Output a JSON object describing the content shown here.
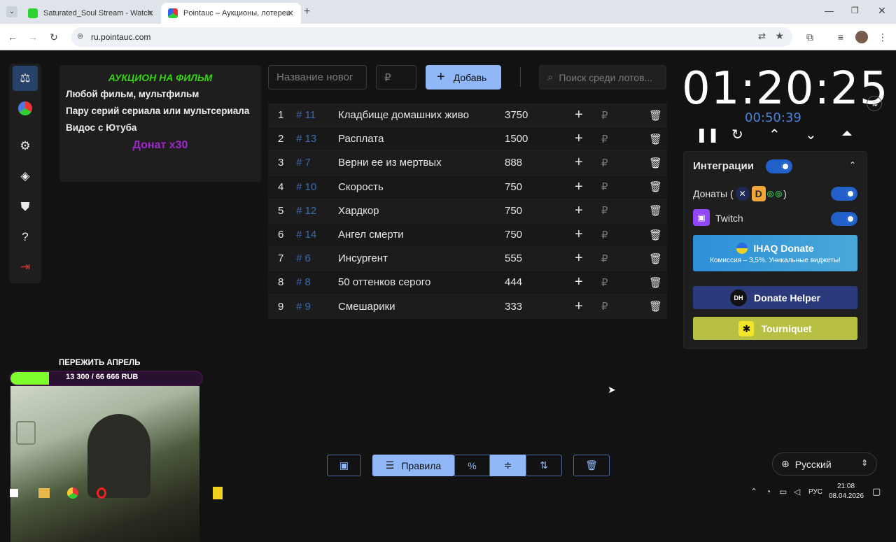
{
  "browser": {
    "tabs": [
      {
        "title": "Saturated_Soul Stream - Watch",
        "active": false
      },
      {
        "title": "Pointauc – Аукционы, лотереи",
        "active": true
      }
    ],
    "url": "ru.pointauc.com"
  },
  "rules": {
    "title": "АУКЦИОН НА ФИЛЬМ",
    "lines": [
      "Любой фильм, мультфильм",
      "Пару серий сериала или мультсериала",
      "Видос с Ютуба"
    ],
    "donate": "Донат x30"
  },
  "toolbar": {
    "name_placeholder": "Название новог",
    "amount_placeholder": "₽",
    "add_label": "Добавь",
    "search_placeholder": "Поиск среди лотов..."
  },
  "lots": [
    {
      "n": "1",
      "id": "# 11",
      "name": "Кладбище домашних живо",
      "amount": "3750"
    },
    {
      "n": "2",
      "id": "# 13",
      "name": "Расплата",
      "amount": "1500"
    },
    {
      "n": "3",
      "id": "# 7",
      "name": "Верни ее из мертвых",
      "amount": "888"
    },
    {
      "n": "4",
      "id": "# 10",
      "name": "Скорость",
      "amount": "750"
    },
    {
      "n": "5",
      "id": "# 12",
      "name": "Хардкор",
      "amount": "750"
    },
    {
      "n": "6",
      "id": "# 14",
      "name": "Ангел смерти",
      "amount": "750"
    },
    {
      "n": "7",
      "id": "# 6",
      "name": "Инсургент",
      "amount": "555"
    },
    {
      "n": "8",
      "id": "# 8",
      "name": "50 оттенков серого",
      "amount": "444"
    },
    {
      "n": "9",
      "id": "# 9",
      "name": "Смешарики",
      "amount": "333"
    }
  ],
  "lot_currency": "₽",
  "timer": {
    "main": "01:20:25",
    "sub": "00:50:39"
  },
  "integrations": {
    "title": "Интеграции",
    "donations_label": "Донаты (",
    "donations_suffix": ")",
    "twitch_label": "Twitch",
    "ihaq_title": "IHAQ Donate",
    "ihaq_sub": "Комиссия – 3,5%. Уникальные виджеты!",
    "donate_helper": "Donate Helper",
    "dh_badge": "DH",
    "tourniquet": "Tourniquet",
    "toggles": {
      "integrations": true,
      "donations": true,
      "twitch": true
    }
  },
  "bottom_toolbar": {
    "rules_label": "Правила",
    "percent_label": "%"
  },
  "language": "Русский",
  "overlay": {
    "goal_title": "ПЕРЕЖИТЬ АПРЕЛЬ",
    "goal_text": "13 300 / 66 666 RUB",
    "goal_fraction": 0.2
  },
  "taskbar": {
    "lang": "РУС",
    "time": "21:08",
    "date": "08.04.2026"
  },
  "colors": {
    "accent": "#90b8f8",
    "green": "#39d315",
    "purple": "#9e28c9",
    "toggle": "#2060c8"
  }
}
